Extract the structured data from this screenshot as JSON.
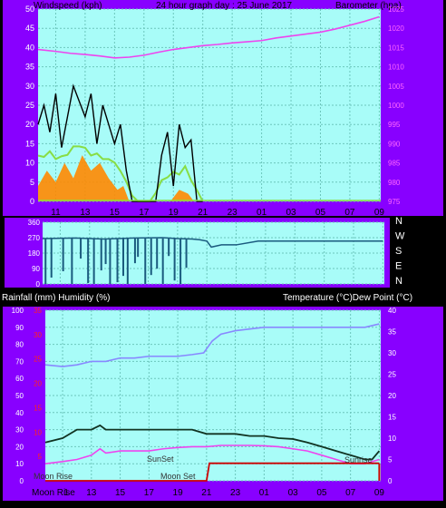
{
  "top_panel": {
    "left_axis_title": "Windspeed (kph)",
    "center_title": "24 hour graph day : 25 June 2017",
    "right_axis_title": "Barometer (hpa)",
    "left_ticks": [
      "0",
      "5",
      "10",
      "15",
      "20",
      "25",
      "30",
      "35",
      "40",
      "45",
      "50"
    ],
    "right_ticks": [
      "975",
      "980",
      "985",
      "990",
      "995",
      "1000",
      "1005",
      "1010",
      "1015",
      "1020",
      "1025"
    ],
    "x_ticks": [
      "11",
      "13",
      "15",
      "17",
      "19",
      "21",
      "23",
      "01",
      "03",
      "05",
      "07",
      "09"
    ]
  },
  "mid_panel": {
    "left_ticks": [
      "0",
      "90",
      "180",
      "270",
      "360"
    ],
    "right_labels": [
      "N",
      "W",
      "S",
      "E",
      "N"
    ]
  },
  "bottom_panel": {
    "title_left": "Rainfall (mm)  Humidity (%)",
    "title_right": "Temperature (°C)Dew Point (°C)",
    "humidity_ticks": [
      "0",
      "10",
      "20",
      "30",
      "40",
      "50",
      "60",
      "70",
      "80",
      "90",
      "100"
    ],
    "rain_ticks": [
      "5",
      "10",
      "15",
      "20",
      "25",
      "30",
      "35"
    ],
    "temp_ticks": [
      "0",
      "5",
      "10",
      "15",
      "20",
      "25",
      "30",
      "35",
      "40"
    ],
    "x_ticks": [
      "1",
      "13",
      "15",
      "17",
      "19",
      "21",
      "23",
      "01",
      "03",
      "05",
      "07",
      "09"
    ],
    "x_prefix": "Moon Rise",
    "annotations": {
      "moon_rise": "Moon Rise",
      "sunset": "SunSet",
      "moon_set": "Moon Set",
      "sunrise": "Sunrise"
    }
  },
  "colors": {
    "frame": "#8800ff",
    "plot_bg": "#a8fcf8",
    "grid": "#6cc6bc",
    "tick_text": "#ffffff",
    "wind": "#000000",
    "gust_area": "#ff8800",
    "avg_wind": "#88dd44",
    "pressure": "#ee44ee",
    "wind_dir": "#1a5a7e",
    "humidity": "#8888ff",
    "temperature": "#113322",
    "dew_point": "#ee44ee",
    "rain": "#cc0000",
    "rain_tick": "#ff2222"
  },
  "chart_data": [
    {
      "type": "line",
      "title": "24 hour graph day : 25 June 2017",
      "xlabel": "",
      "ylabel": "Windspeed (kph)",
      "y2label": "Barometer (hpa)",
      "x_hours": [
        "10",
        "11",
        "12",
        "13",
        "14",
        "15",
        "16",
        "17",
        "18",
        "19",
        "20",
        "21",
        "22",
        "23",
        "00",
        "01",
        "02",
        "03",
        "04",
        "05",
        "06",
        "07",
        "08",
        "09"
      ],
      "ylim": [
        0,
        50
      ],
      "y2lim": [
        975,
        1025
      ],
      "series": [
        {
          "name": "Barometer (hpa)",
          "axis": "right",
          "x": [
            9.8,
            11,
            12,
            13,
            14,
            15,
            16,
            17,
            18,
            19,
            20,
            21,
            22,
            23,
            24,
            25,
            26,
            27,
            28,
            29,
            30,
            31,
            32,
            33
          ],
          "values": [
            1014.5,
            1014.0,
            1013.5,
            1013.2,
            1012.8,
            1012.3,
            1012.5,
            1013.0,
            1013.8,
            1014.5,
            1015.0,
            1015.5,
            1015.8,
            1016.2,
            1016.5,
            1016.8,
            1017.5,
            1018.0,
            1018.5,
            1019.0,
            1019.8,
            1020.8,
            1021.8,
            1023.0
          ]
        },
        {
          "name": "Windspeed (kph)",
          "axis": "left",
          "x": [
            9.8,
            10.2,
            10.6,
            11,
            11.4,
            11.8,
            12.2,
            12.6,
            13,
            13.4,
            13.8,
            14.2,
            14.6,
            15,
            15.4,
            15.8,
            16.2,
            16.6,
            17,
            17.4,
            17.8,
            18.2,
            18.6,
            19,
            19.4,
            19.8,
            20.2,
            20.6,
            21
          ],
          "values": [
            20,
            25,
            18,
            28,
            14,
            22,
            30,
            26,
            22,
            28,
            15,
            25,
            20,
            15,
            20,
            8,
            0,
            0,
            0,
            0,
            0,
            12,
            18,
            4,
            20,
            14,
            16,
            0,
            0
          ]
        },
        {
          "name": "Gust",
          "axis": "left",
          "x": [
            9.8,
            10.4,
            11,
            11.6,
            12.2,
            12.8,
            13.4,
            14,
            14.6,
            15.2,
            15.6,
            16,
            18.8,
            19.4,
            20,
            20.4,
            21
          ],
          "values": [
            4,
            8,
            5,
            10,
            6,
            12,
            8,
            10,
            6,
            3,
            4,
            0,
            0,
            3,
            2,
            0,
            0
          ]
        }
      ]
    },
    {
      "type": "line",
      "ylabel": "",
      "ylim": [
        0,
        360
      ],
      "series": [
        {
          "name": "Wind direction",
          "x": [
            9.8,
            12,
            14,
            16,
            18,
            19,
            20,
            20.5,
            21,
            21.3,
            22,
            23,
            24.5,
            33
          ],
          "values": [
            265,
            268,
            262,
            268,
            270,
            265,
            262,
            258,
            250,
            215,
            228,
            228,
            250,
            250
          ]
        }
      ]
    },
    {
      "type": "line",
      "ylim": [
        0,
        100
      ],
      "y2lim": [
        0,
        40
      ],
      "series": [
        {
          "name": "Humidity (%)",
          "axis": "left",
          "x": [
            9.8,
            11,
            12,
            13,
            14,
            15,
            16,
            17,
            18,
            19,
            20,
            20.8,
            21.4,
            22,
            23,
            24,
            25,
            26,
            27,
            28,
            29,
            30,
            31,
            32,
            33
          ],
          "values": [
            68,
            67,
            68,
            70,
            70,
            72,
            72,
            73,
            73,
            73,
            74,
            75,
            82,
            86,
            88,
            89,
            90,
            90,
            90,
            90,
            90,
            90,
            90,
            90,
            92
          ]
        },
        {
          "name": "Temperature (°C)",
          "axis": "right",
          "x": [
            9.8,
            11,
            12,
            13,
            13.6,
            14,
            15,
            16,
            17,
            18,
            19,
            20,
            21,
            22,
            23,
            24,
            25,
            26,
            27,
            28,
            29,
            30,
            31,
            32,
            32.5,
            33
          ],
          "values": [
            9,
            10,
            12,
            12,
            13,
            12,
            12,
            12,
            12,
            12,
            12,
            12,
            11,
            11,
            11,
            10.5,
            10.5,
            10,
            9.8,
            9,
            8,
            7,
            6,
            5,
            5,
            7
          ]
        },
        {
          "name": "Dew Point (°C)",
          "axis": "right",
          "x": [
            9.8,
            11,
            12,
            13,
            13.6,
            14,
            15,
            16,
            17,
            18,
            19,
            20,
            21,
            22,
            23,
            24,
            25,
            26,
            27,
            28,
            29,
            30,
            31,
            32,
            33
          ],
          "values": [
            4,
            4.5,
            5,
            6,
            7.5,
            6.5,
            7,
            7,
            7,
            7.5,
            7.8,
            8,
            8,
            8.3,
            8.3,
            8.3,
            8.2,
            8,
            7.5,
            7,
            6,
            5,
            4,
            4,
            5
          ]
        },
        {
          "name": "Rainfall (mm)",
          "axis": "rain",
          "x": [
            9.8,
            20,
            21,
            21.2,
            33
          ],
          "values": [
            0,
            0,
            0,
            1.2,
            1.2
          ]
        }
      ]
    }
  ]
}
